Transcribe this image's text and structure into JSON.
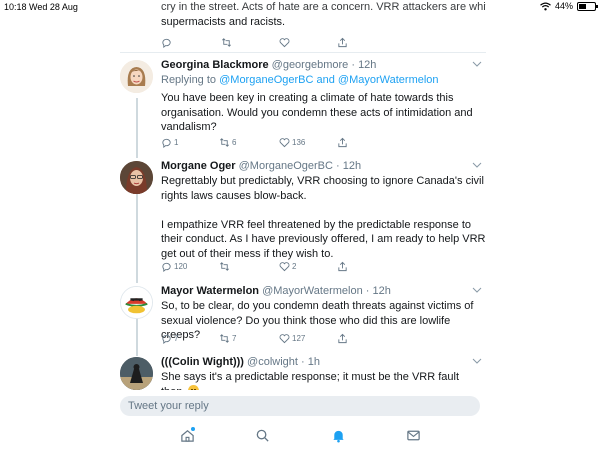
{
  "status_bar": {
    "time": "10:18",
    "date": "Wed 28 Aug",
    "battery": "44%",
    "battery_level": 0.44
  },
  "previous_tweet": {
    "text_line1": "cry in the street. Acts of hate are a concern. VRR attackers are white",
    "text_line2": "supermacists and racists.",
    "reply_count": "",
    "retweet_count": "",
    "like_count": ""
  },
  "tweets": [
    {
      "name": "Georgina Blackmore",
      "handle": "@georgebmore",
      "dot": "·",
      "age": "12h",
      "reply_to_prefix": "Replying to",
      "reply_to_1": "@MorganeOgerBC",
      "reply_to_and": "and",
      "reply_to_2": "@MayorWatermelon",
      "p1": "You have been key in creating a climate of hate towards this organisation. Would you condemn these acts of intimidation and vandalism?",
      "reply_count": "1",
      "retweet_count": "6",
      "like_count": "136"
    },
    {
      "name": "Morgane Oger",
      "handle": "@MorganeOgerBC",
      "dot": "·",
      "age": "12h",
      "p1": "Regrettably but predictably, VRR choosing to ignore Canada's civil rights laws causes blow-back.",
      "p2": "I empathize VRR feel threatened by the predictable response to their conduct.  As I have previously offered, I am ready to help VRR get out of their mess if they wish to.",
      "reply_count": "120",
      "retweet_count": "",
      "like_count": "2"
    },
    {
      "name": "Mayor Watermelon",
      "handle": "@MayorWatermelon",
      "dot": "·",
      "age": "12h",
      "p1": "So, to be clear, do you condemn death threats against victims of sexual violence? Do you think those who did this are lowlife creeps?",
      "reply_count": "7",
      "retweet_count": "7",
      "like_count": "127"
    },
    {
      "name": "(((Colin Wight)))",
      "handle": "@colwight",
      "dot": "·",
      "age": "1h",
      "p1": "She says it's a predictable response; it must be the VRR fault then.",
      "emoji": "grimacing-face"
    }
  ],
  "composer": {
    "placeholder": "Tweet your reply"
  },
  "tabbar": {
    "items": [
      "home-icon",
      "search-icon",
      "notifications-icon",
      "messages-icon"
    ],
    "active": "notifications-icon"
  },
  "colors": {
    "accent": "#1da1f2",
    "muted": "#657786",
    "text": "#14171a",
    "composer_bg": "#e9edf1"
  }
}
